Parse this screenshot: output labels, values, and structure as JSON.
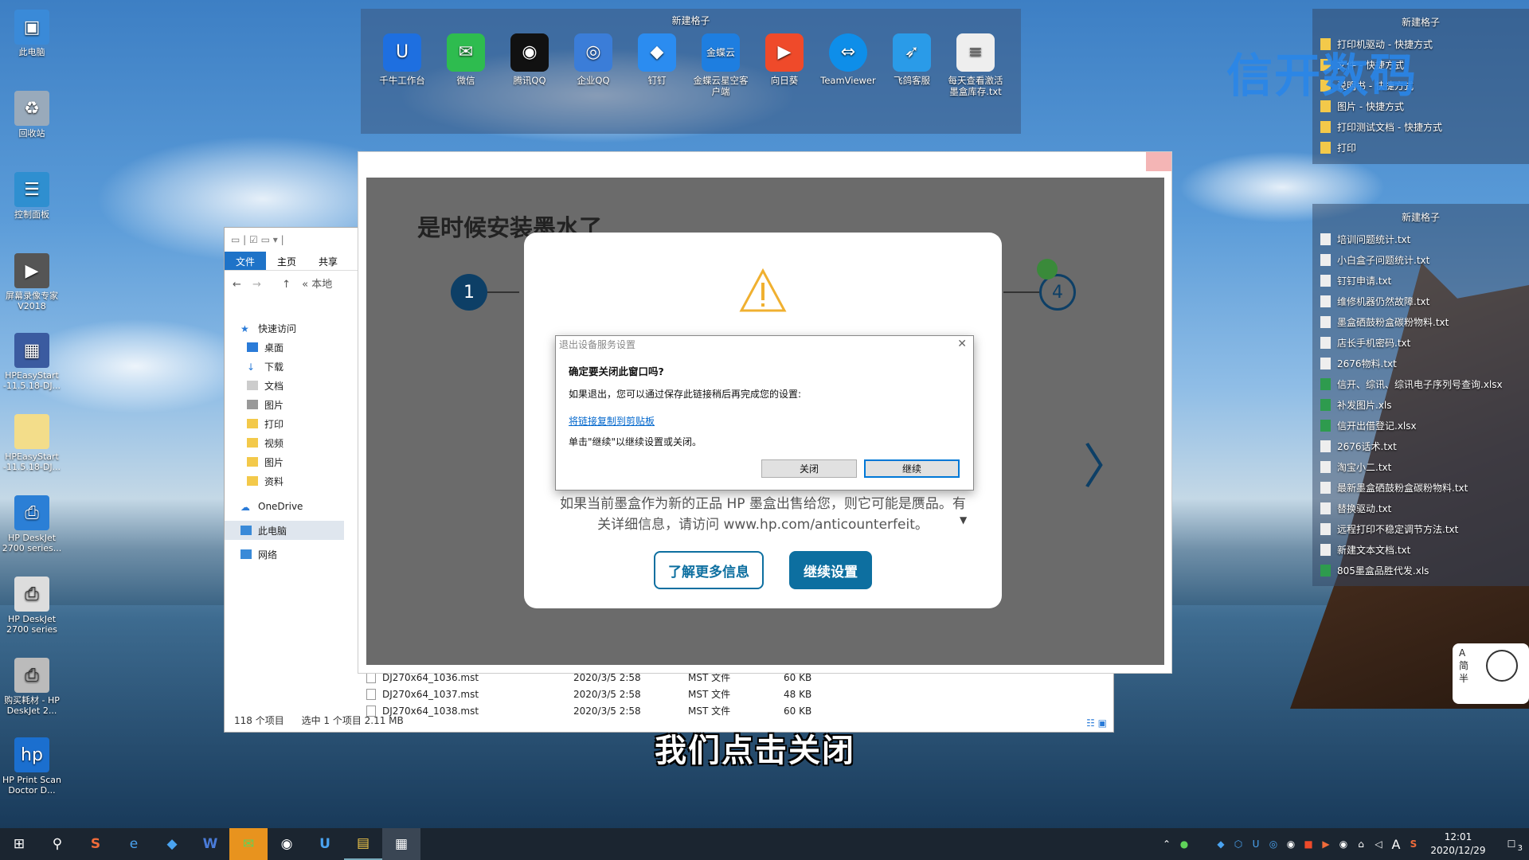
{
  "desktop_icons": [
    {
      "label": "此电脑",
      "icon": "computer-icon",
      "color": "#3a8ad8"
    },
    {
      "label": "回收站",
      "icon": "recycle-bin-icon",
      "color": "#9ab"
    },
    {
      "label": "控制面板",
      "icon": "control-panel-icon",
      "color": "#2f8fd0"
    },
    {
      "label": "屏幕录像专家 V2018",
      "icon": "screen-recorder-icon",
      "color": "#555"
    },
    {
      "label": "HPEasyStart -11.5.18-DJ...",
      "icon": "hp-easystart-icon",
      "color": "#3b5ba0"
    },
    {
      "label": "HPEasyStart -11.5.18-DJ...",
      "icon": "folder-icon",
      "color": "#f3dd8a"
    },
    {
      "label": "HP DeskJet 2700 series...",
      "icon": "printer-icon",
      "color": "#2b7fd6"
    },
    {
      "label": "HP DeskJet 2700 series",
      "icon": "printer-icon",
      "color": "#ddd"
    },
    {
      "label": "购买耗材 - HP DeskJet 2...",
      "icon": "printer-icon",
      "color": "#bbb"
    },
    {
      "label": "HP Print Scan Doctor D...",
      "icon": "hp-doctor-icon",
      "color": "#1b6fcf"
    }
  ],
  "fence_top": {
    "title": "新建格子",
    "items": [
      {
        "label": "千牛工作台",
        "icon": "qianniu-icon",
        "color": "#1e6fe0"
      },
      {
        "label": "微信",
        "icon": "wechat-icon",
        "color": "#2ebc4f"
      },
      {
        "label": "腾讯QQ",
        "icon": "qq-icon",
        "color": "#111"
      },
      {
        "label": "企业QQ",
        "icon": "enterprise-qq-icon",
        "color": "#3b7dd8"
      },
      {
        "label": "钉钉",
        "icon": "dingtalk-icon",
        "color": "#2b8cf0"
      },
      {
        "label": "金蝶云星空客户端",
        "icon": "kingdee-icon",
        "color": "#1e7ee0"
      },
      {
        "label": "向日葵",
        "icon": "sunlogin-icon",
        "color": "#ef4a2a"
      },
      {
        "label": "TeamViewer",
        "icon": "teamviewer-icon",
        "color": "#0e8ee9"
      },
      {
        "label": "飞鸽客服",
        "icon": "feige-icon",
        "color": "#2a9be8"
      },
      {
        "label": "每天查看激活墨盒库存.txt",
        "icon": "text-file-icon",
        "color": "#eee"
      }
    ]
  },
  "fence_right_1": {
    "title": "新建格子",
    "items": [
      "打印机驱动 - 快捷方式",
      "文件 - 快捷方式",
      "说明书 - 快捷方式",
      "图片 - 快捷方式",
      "打印测试文档 - 快捷方式",
      "打印"
    ]
  },
  "fence_right_2": {
    "title": "新建格子",
    "items": [
      {
        "label": "培训问题统计.txt",
        "type": "txt"
      },
      {
        "label": "小白盒子问题统计.txt",
        "type": "txt"
      },
      {
        "label": "钉钉申请.txt",
        "type": "txt"
      },
      {
        "label": "维修机器仍然故障.txt",
        "type": "txt"
      },
      {
        "label": "墨盒硒鼓粉盒碳粉物料.txt",
        "type": "txt"
      },
      {
        "label": "店长手机密码.txt",
        "type": "txt"
      },
      {
        "label": "2676物料.txt",
        "type": "txt"
      },
      {
        "label": "信开、综讯、综讯电子序列号查询.xlsx",
        "type": "xlsx"
      },
      {
        "label": "补发图片.xls",
        "type": "xlsx"
      },
      {
        "label": "信开出借登记.xlsx",
        "type": "xlsx"
      },
      {
        "label": "2676话术.txt",
        "type": "txt"
      },
      {
        "label": "淘宝小二.txt",
        "type": "txt"
      },
      {
        "label": "最新墨盒硒鼓粉盒碳粉物料.txt",
        "type": "txt"
      },
      {
        "label": "替换驱动.txt",
        "type": "txt"
      },
      {
        "label": "远程打印不稳定调节方法.txt",
        "type": "txt"
      },
      {
        "label": "新建文本文档.txt",
        "type": "txt"
      },
      {
        "label": "805墨盒品胜代发.xls",
        "type": "xlsx"
      }
    ]
  },
  "watermark_logo": "信开数码",
  "explorer": {
    "tabs": [
      "文件",
      "主页",
      "共享"
    ],
    "path": "« 本地",
    "nav": [
      {
        "label": "快速访问",
        "icon": "star-icon"
      },
      {
        "label": "桌面",
        "icon": "desktop-icon"
      },
      {
        "label": "下载",
        "icon": "download-icon"
      },
      {
        "label": "文档",
        "icon": "document-icon"
      },
      {
        "label": "图片",
        "icon": "picture-icon"
      },
      {
        "label": "打印",
        "icon": "folder-icon"
      },
      {
        "label": "视频",
        "icon": "folder-icon"
      },
      {
        "label": "图片",
        "icon": "folder-icon"
      },
      {
        "label": "资料",
        "icon": "folder-icon"
      },
      {
        "label": "OneDrive",
        "icon": "cloud-icon"
      },
      {
        "label": "此电脑",
        "icon": "computer-icon"
      },
      {
        "label": "网络",
        "icon": "network-icon"
      }
    ],
    "files": [
      {
        "name": "DJ270x64_1036.mst",
        "date": "2020/3/5 2:58",
        "type": "MST 文件",
        "size": "60 KB"
      },
      {
        "name": "DJ270x64_1037.mst",
        "date": "2020/3/5 2:58",
        "type": "MST 文件",
        "size": "48 KB"
      },
      {
        "name": "DJ270x64_1038.mst",
        "date": "2020/3/5 2:58",
        "type": "MST 文件",
        "size": "60 KB"
      }
    ],
    "status_count": "118 个项目",
    "status_selected": "选中 1 个项目  2.11 MB"
  },
  "hp_setup": {
    "title": "是时候安装墨水了",
    "step_first": "1",
    "step_last": "4",
    "body_text": "如果当前墨盒作为新的正品 HP 墨盒出售给您，则它可能是赝品。有关详细信息，请访问 www.hp.com/anticounterfeit。",
    "learn_more": "了解更多信息",
    "continue_setup": "继续设置"
  },
  "exit_dialog": {
    "title": "退出设备服务设置",
    "question": "确定要关闭此窗口吗?",
    "info": "如果退出，您可以通过保存此链接稍后再完成您的设置:",
    "link": "将链接复制到剪贴板",
    "instruction": "单击\"继续\"以继续设置或关闭。",
    "close_button": "关闭",
    "continue_button": "继续"
  },
  "subtitle": "我们点击关闭",
  "sticker_text": "A 简 半",
  "taskbar": {
    "apps": [
      {
        "name": "start-button",
        "glyph": "⊞"
      },
      {
        "name": "search-button",
        "glyph": "⚲"
      },
      {
        "name": "sogou-icon",
        "glyph": "S"
      },
      {
        "name": "browser-icon",
        "glyph": "e"
      },
      {
        "name": "dingtalk-taskbar-icon",
        "glyph": "◆"
      },
      {
        "name": "wps-icon",
        "glyph": "W"
      },
      {
        "name": "wechat-taskbar-icon",
        "glyph": "✉"
      },
      {
        "name": "qq-taskbar-icon",
        "glyph": "◉"
      },
      {
        "name": "qianniu-taskbar-icon",
        "glyph": "U"
      },
      {
        "name": "file-explorer-icon",
        "glyph": "▤"
      },
      {
        "name": "hp-setup-icon",
        "glyph": "▦"
      }
    ],
    "time": "12:01",
    "date": "2020/12/29",
    "ime": "A",
    "notification_count": "3"
  }
}
